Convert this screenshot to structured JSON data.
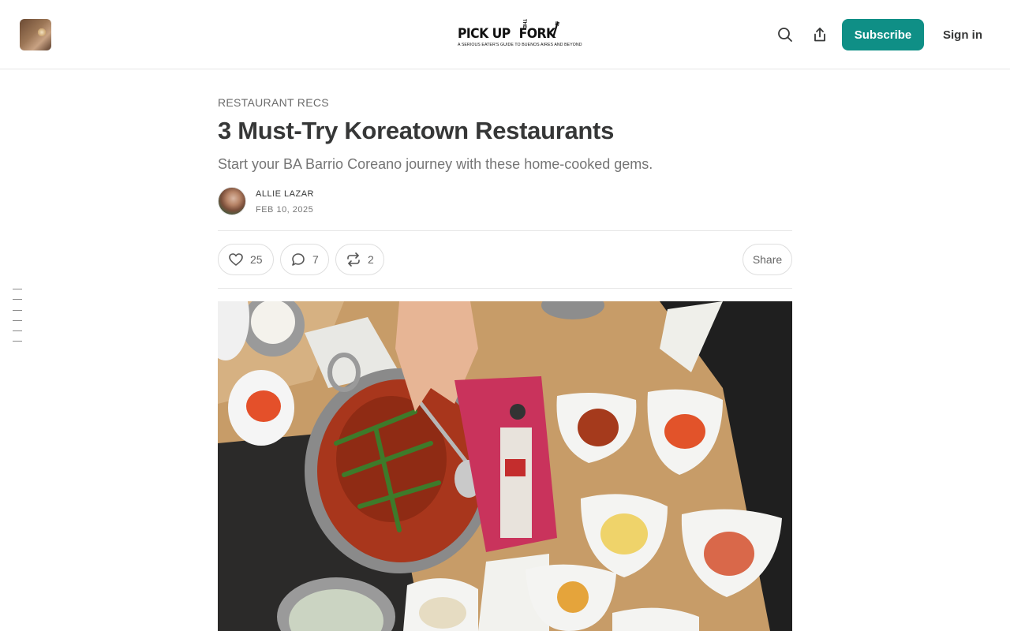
{
  "header": {
    "logo_text": "PICK UP",
    "logo_text_small": "THE",
    "logo_text_end": "FORK",
    "logo_tagline": "A SERIOUS EATER'S GUIDE TO BUENOS AIRES AND BEYOND",
    "subscribe_label": "Subscribe",
    "signin_label": "Sign in",
    "icons": [
      "search-icon",
      "share-icon"
    ]
  },
  "post": {
    "category": "RESTAURANT RECS",
    "title": "3 Must-Try Koreatown Restaurants",
    "subtitle": "Start your BA Barrio Coreano journey with these home-cooked gems.",
    "author": "ALLIE LAZAR",
    "date": "FEB 10, 2025"
  },
  "actions": {
    "likes": "25",
    "comments": "7",
    "restacks": "2",
    "share_label": "Share"
  },
  "colors": {
    "accent": "#0f8f86",
    "text": "#363737",
    "muted": "#757575"
  }
}
